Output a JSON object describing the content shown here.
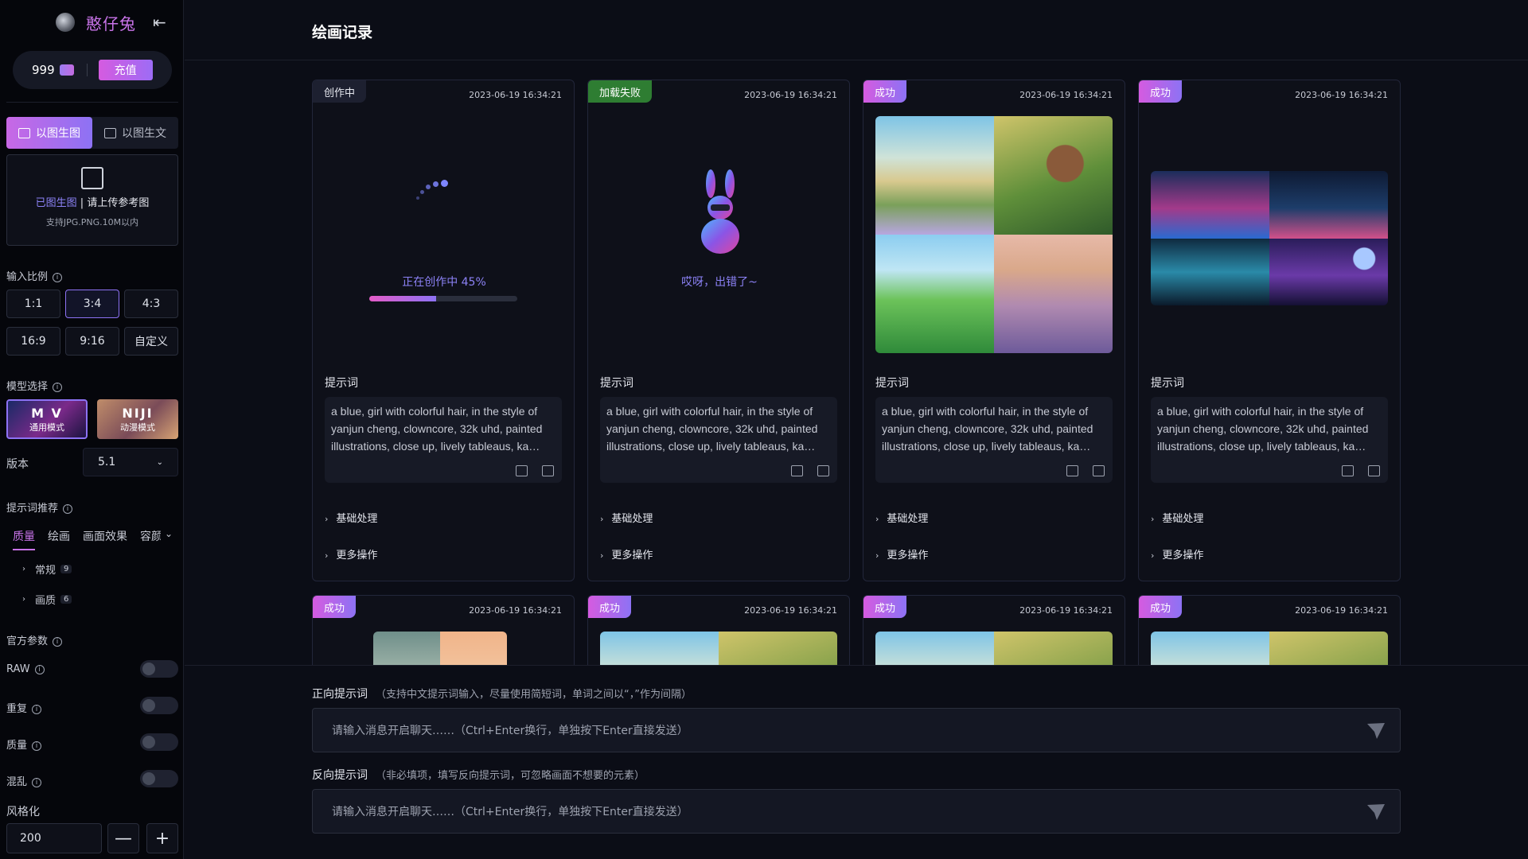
{
  "sidebar": {
    "brand": "憨仔兔",
    "balance": "999",
    "recharge": "充值",
    "mode_tabs": [
      "以图生图",
      "以图生文"
    ],
    "upload": {
      "highlight": "已图生图",
      "divider": "|",
      "prompt": "请上传参考图",
      "hint": "支持JPG.PNG.10M以内"
    },
    "ratio_label": "输入比例",
    "ratios": [
      "1:1",
      "3:4",
      "4:3",
      "16:9",
      "9:16",
      "自定义"
    ],
    "selected_ratio": "3:4",
    "model_label": "模型选择",
    "models": [
      {
        "title": "M V",
        "subtitle": "通用模式"
      },
      {
        "title": "NIJI",
        "subtitle": "动漫模式"
      }
    ],
    "version_label": "版本",
    "version_value": "5.1",
    "prompt_rec_label": "提示词推荐",
    "prompt_tabs": [
      "质量",
      "绘画",
      "画面效果",
      "容颜"
    ],
    "tree": [
      {
        "label": "常规",
        "count": "9"
      },
      {
        "label": "画质",
        "count": "6"
      }
    ],
    "official_label": "官方参数",
    "toggles": [
      "RAW",
      "重复",
      "质量",
      "混乱"
    ],
    "stylize_label": "风格化",
    "stylize_value": "200",
    "minus": "—",
    "plus": "+"
  },
  "main": {
    "title": "绘画记录",
    "prompt_label": "提示词",
    "prompt_text": "a blue, girl with colorful hair, in the style of yanjun cheng, clowncore, 32k uhd, painted illustrations, close up, lively tableaus, ka…",
    "basic": "基础处理",
    "more": "更多操作",
    "cards": [
      {
        "status": "创作中",
        "time": "2023-06-19  16:34:21",
        "progress_text": "正在创作中 45%",
        "progress": 0.45
      },
      {
        "status": "加载失败",
        "time": "2023-06-19  16:34:21",
        "error_text": "哎呀，出错了~"
      },
      {
        "status": "成功",
        "time": "2023-06-19  16:34:21"
      },
      {
        "status": "成功",
        "time": "2023-06-19  16:34:21"
      },
      {
        "status": "成功",
        "time": "2023-06-19  16:34:21"
      },
      {
        "status": "成功",
        "time": "2023-06-19  16:34:21"
      },
      {
        "status": "成功",
        "time": "2023-06-19  16:34:21"
      },
      {
        "status": "成功",
        "time": "2023-06-19  16:34:21"
      }
    ]
  },
  "bottom": {
    "positive_label": "正向提示词",
    "positive_hint": "（支持中文提示词输入，尽量使用简短词，单词之间以“，”作为间隔）",
    "negative_label": "反向提示词",
    "negative_hint": "（非必填项，填写反向提示词，可忽略画面不想要的元素）",
    "placeholder": "请输入消息开启聊天……（Ctrl+Enter换行，单独按下Enter直接发送）"
  },
  "colors": {
    "accent": "#c873e8",
    "accent2": "#8d72f4",
    "fail": "#2e7d32"
  }
}
